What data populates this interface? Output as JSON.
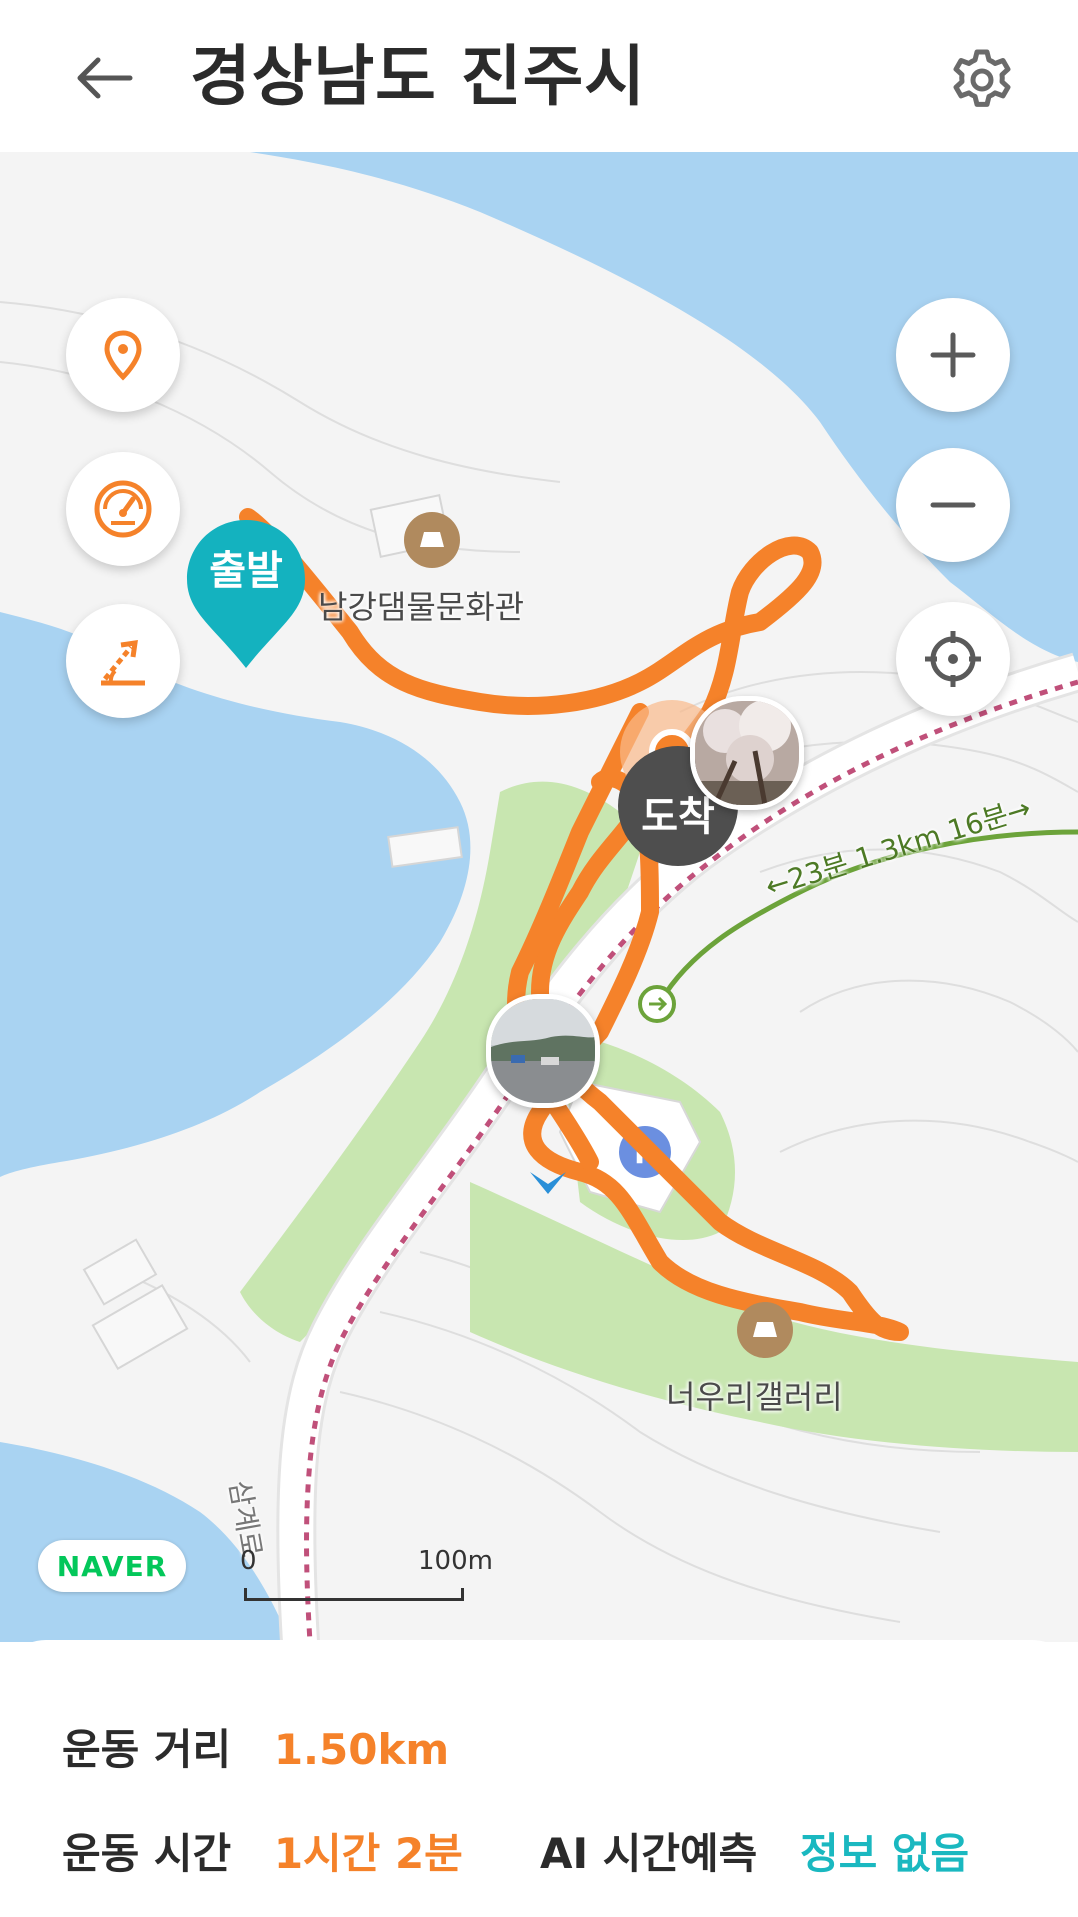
{
  "header": {
    "title": "경상남도 진주시",
    "back_icon": "arrow-left-icon",
    "settings_icon": "gear-icon"
  },
  "map": {
    "markers": {
      "start_label": "출발",
      "end_label": "도착"
    },
    "poi": [
      {
        "label": "남강댐물문화관"
      },
      {
        "label": "너우리갤러리"
      }
    ],
    "road_label": "삼계로",
    "route_hint": "←23분 1.3km 16분→",
    "attribution": "NAVER",
    "scale": {
      "start": "0",
      "end": "100m"
    },
    "controls_left": [
      "location-pin-icon",
      "speedometer-icon",
      "elevation-slope-icon"
    ],
    "controls_right": [
      "zoom-in-icon",
      "zoom-out-icon",
      "my-location-icon"
    ]
  },
  "stats": {
    "distance_label": "운동 거리",
    "distance_value": "1.50km",
    "time_label": "운동 시간",
    "time_value": "1시간 2분",
    "ai_label": "AI 시간예측",
    "ai_value": "정보 없음"
  },
  "colors": {
    "route": "#f5822a",
    "start_marker": "#14b2bf",
    "end_marker": "#4e4e4e",
    "water": "#a9d3f2",
    "park": "#c8e6b0",
    "accent_teal": "#1ab8c0"
  }
}
